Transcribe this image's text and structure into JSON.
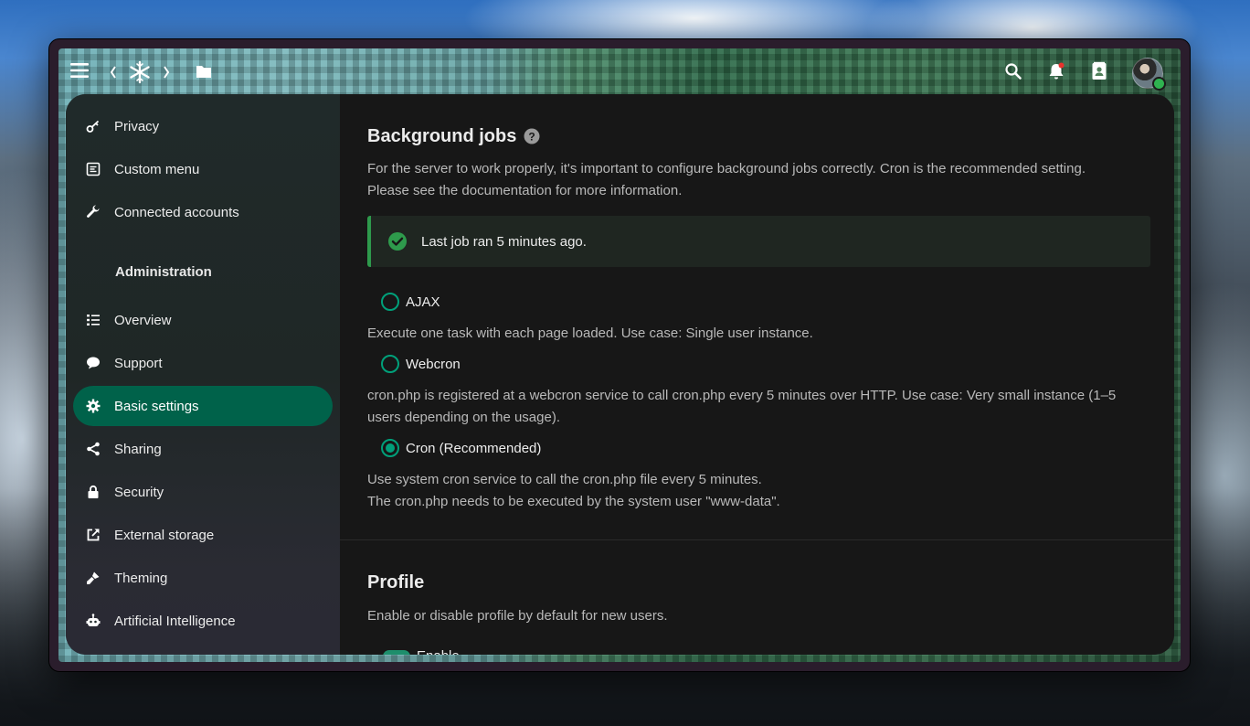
{
  "colors": {
    "accent": "#00624a",
    "radio": "#00a07a",
    "success": "#2e9a4c",
    "notification_dot": "#e9322d",
    "online_status": "#2fb350"
  },
  "topbar": {
    "icons": [
      "menu-icon",
      "app-logo",
      "files-icon",
      "search-icon",
      "notifications-icon",
      "contacts-icon",
      "user-avatar"
    ]
  },
  "sidebar": {
    "items": [
      {
        "label": "Privacy",
        "icon": "key-icon"
      },
      {
        "label": "Custom menu",
        "icon": "menu-list-icon"
      },
      {
        "label": "Connected accounts",
        "icon": "wrench-icon"
      }
    ],
    "admin_heading": "Administration",
    "admin_items": [
      {
        "label": "Overview",
        "icon": "list-icon"
      },
      {
        "label": "Support",
        "icon": "chat-icon"
      },
      {
        "label": "Basic settings",
        "icon": "gear-icon",
        "active": true
      },
      {
        "label": "Sharing",
        "icon": "share-icon"
      },
      {
        "label": "Security",
        "icon": "lock-icon"
      },
      {
        "label": "External storage",
        "icon": "external-link-icon"
      },
      {
        "label": "Theming",
        "icon": "brush-icon"
      },
      {
        "label": "Artificial Intelligence",
        "icon": "robot-icon"
      }
    ]
  },
  "background_jobs": {
    "title": "Background jobs",
    "description_1": "For the server to work properly, it's important to configure background jobs correctly. Cron is the recommended setting.",
    "description_2": "Please see the documentation for more information.",
    "status": "Last job ran 5 minutes ago.",
    "options": [
      {
        "label": "AJAX",
        "checked": false,
        "desc_1": "Execute one task with each page loaded. Use case: Single user instance."
      },
      {
        "label": "Webcron",
        "checked": false,
        "desc_1": "cron.php is registered at a webcron service to call cron.php every 5 minutes over HTTP. Use case: Very small instance (1–5",
        "desc_2": "users depending on the usage)."
      },
      {
        "label": "Cron (Recommended)",
        "checked": true,
        "desc_1": "Use system cron service to call the cron.php file every 5 minutes.",
        "desc_2": "The cron.php needs to be executed by the system user \"www-data\"."
      }
    ]
  },
  "profile": {
    "title": "Profile",
    "description": "Enable or disable profile by default for new users.",
    "toggle_label": "Enable"
  }
}
